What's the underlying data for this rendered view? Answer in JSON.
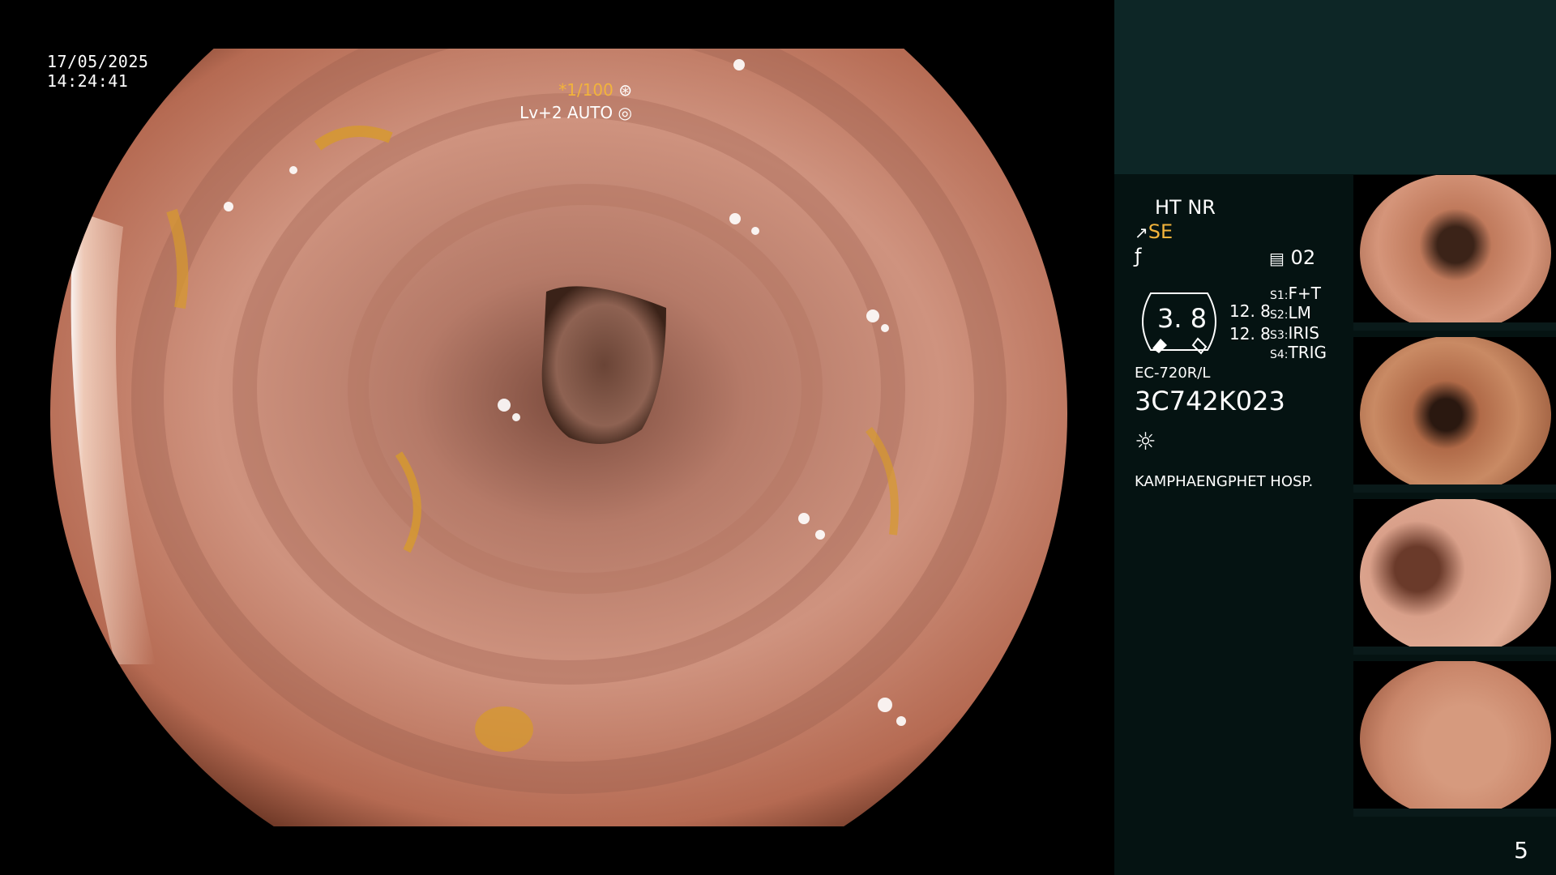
{
  "overlay": {
    "date": "17/05/2025",
    "time": "14:24:41",
    "shutter": "*1/100",
    "level": "Lv+2 AUTO"
  },
  "panel": {
    "ht_nr": "HT NR",
    "se": "SE",
    "memo_count": "02",
    "gauge_value": "3. 8",
    "val_a": "12. 8",
    "val_b": "12. 8",
    "s1_label": "S1:",
    "s1_value": "F+T",
    "s2_label": "S2:",
    "s2_value": "LM",
    "s3_label": "S3:",
    "s3_value": "IRIS",
    "s4_label": "S4:",
    "s4_value": "TRIG",
    "scope_model": "EC-720R/L",
    "serial": "3C742K023",
    "hospital": "KAMPHAENGPHET HOSP."
  },
  "icons": {
    "shutter": "shutter-icon",
    "level": "iris-icon",
    "se": "scope-se-icon",
    "f": "function-icon",
    "memo": "memo-icon",
    "light": "light-icon"
  },
  "colors": {
    "accent_yellow": "#f2b33b",
    "panel_top": "#0d2626",
    "panel_bottom": "#051312",
    "tissue": "#c98b78"
  },
  "page_number": "5"
}
